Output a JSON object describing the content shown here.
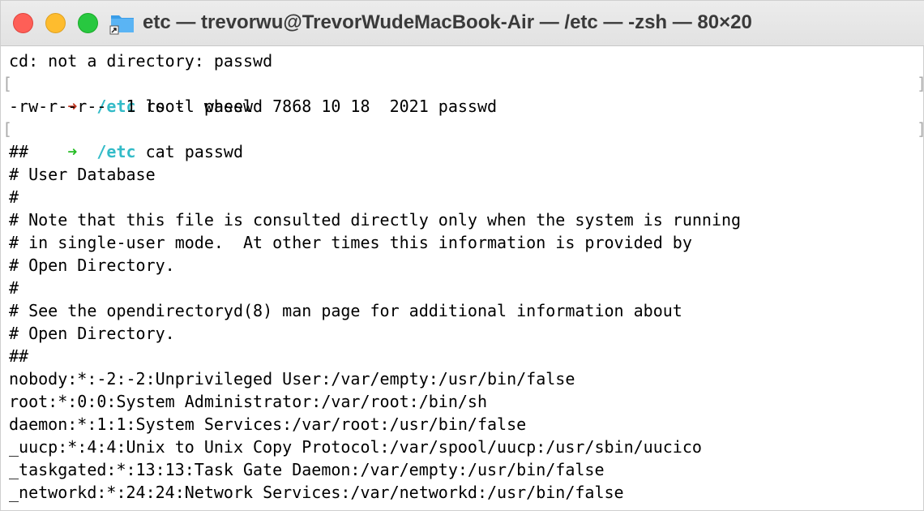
{
  "window": {
    "title": "etc — trevorwu@TrevorWudeMacBook-Air — /etc — -zsh — 80×20",
    "colors": {
      "close": "#fe5f57",
      "minimize": "#febc2e",
      "maximize": "#28c840",
      "prompt_error": "#c23621",
      "prompt_ok": "#25bc24",
      "cwd": "#33bbc8"
    }
  },
  "terminal": {
    "line0": "cd: not a directory: passwd",
    "prompt1": {
      "arrow": "➜",
      "cwd": "/etc",
      "command": " ls -l passwd",
      "status": "error"
    },
    "line2": "-rw-r--r--  1 root  wheel  7868 10 18  2021 passwd",
    "prompt2": {
      "arrow": "➜",
      "cwd": "/etc",
      "command": " cat passwd",
      "status": "ok"
    },
    "output": [
      "##",
      "# User Database",
      "#",
      "# Note that this file is consulted directly only when the system is running",
      "# in single-user mode.  At other times this information is provided by",
      "# Open Directory.",
      "#",
      "# See the opendirectoryd(8) man page for additional information about",
      "# Open Directory.",
      "##",
      "nobody:*:-2:-2:Unprivileged User:/var/empty:/usr/bin/false",
      "root:*:0:0:System Administrator:/var/root:/bin/sh",
      "daemon:*:1:1:System Services:/var/root:/usr/bin/false",
      "_uucp:*:4:4:Unix to Unix Copy Protocol:/var/spool/uucp:/usr/sbin/uucico",
      "_taskgated:*:13:13:Task Gate Daemon:/var/empty:/usr/bin/false",
      "_networkd:*:24:24:Network Services:/var/networkd:/usr/bin/false"
    ]
  },
  "icons": {
    "folder": "folder-alias-icon",
    "mark": "mark-bracket"
  }
}
